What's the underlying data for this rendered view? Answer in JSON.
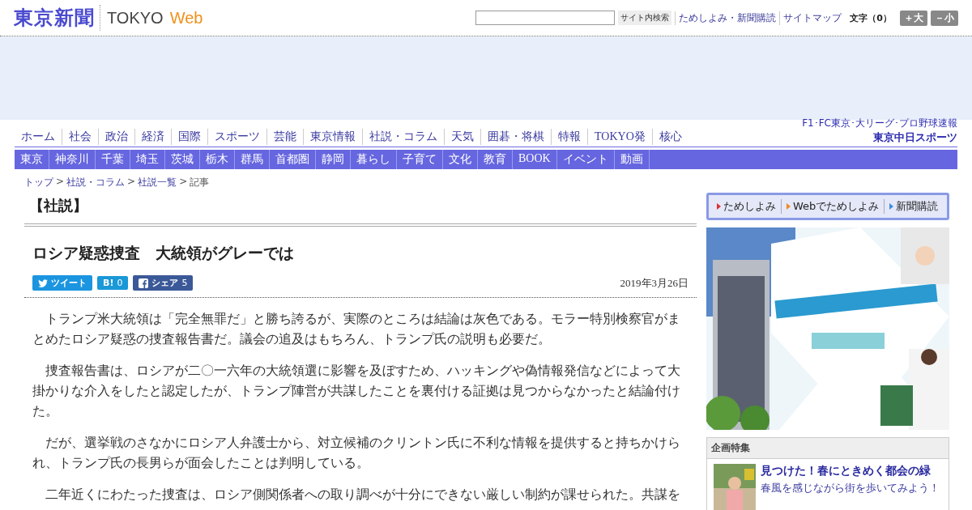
{
  "header": {
    "logo_ja": "東京新聞",
    "logo_en": "TOKYO",
    "logo_web": "Web",
    "search_button": "サイト内検索",
    "links": [
      "ためしよみ・新聞購読",
      "サイトマップ"
    ],
    "font_size_label": "文字（0）",
    "font_buttons": [
      "＋大",
      "－小"
    ]
  },
  "ad_band": {
    "kind": "empty"
  },
  "nav_main": [
    "ホーム",
    "社会",
    "政治",
    "経済",
    "国際",
    "スポーツ",
    "芸能",
    "東京情報",
    "社説・コラム",
    "天気",
    "囲碁・将棋",
    "特報",
    "TOKYO発",
    "核心"
  ],
  "sports_banner": {
    "line1": "F1･FC東京･大リーグ･プロ野球速報",
    "line2": "東京中日スポーツ"
  },
  "nav_regional": [
    "東京",
    "神奈川",
    "千葉",
    "埼玉",
    "茨城",
    "栃木",
    "群馬",
    "首都圏",
    "静岡",
    "暮らし",
    "子育て",
    "文化",
    "教育",
    "BOOK",
    "イベント",
    "動画"
  ],
  "breadcrumb": [
    "トップ",
    "社説・コラム",
    "社説一覧",
    "記事"
  ],
  "breadcrumb_separator": ">",
  "section_title": "【社説】",
  "article": {
    "title": "ロシア疑惑捜査　大統領がグレーでは",
    "share": [
      {
        "kind": "twitter",
        "label": "ツイート"
      },
      {
        "kind": "hatena",
        "label": "B!",
        "count": "0"
      },
      {
        "kind": "facebook",
        "label": "シェア",
        "count": "5"
      }
    ],
    "date": "2019年3月26日",
    "paragraphs": [
      "トランプ米大統領は「完全無罪だ」と勝ち誇るが、実際のところは結論は灰色である。モラー特別検察官がまとめたロシア疑惑の捜査報告書だ。議会の追及はもちろん、トランプ氏の説明も必要だ。",
      "捜査報告書は、ロシアが二〇一六年の大統領選に影響を及ぼすため、ハッキングや偽情報発信などによって大掛かりな介入をしたと認定したが、トランプ陣営が共謀したことを裏付ける証拠は見つからなかったと結論付けた。",
      "だが、選挙戦のさなかにロシア人弁護士から、対立候補のクリントン氏に不利な情報を提供すると持ちかけられ、トランプ氏の長男らが面会したことは判明している。",
      "二年近くにわたった捜査は、ロシア側関係者への取り調べが十分にできない厳しい制約が課せられた。共謀を"
    ]
  },
  "sidebar": {
    "subscribe_links": [
      {
        "label": "ためしよみ",
        "color": "#e03030"
      },
      {
        "label": "Webでためしよみ",
        "color": "#f08a20"
      },
      {
        "label": "新聞購読",
        "color": "#3a8ee0"
      }
    ],
    "feature": {
      "heading": "企画特集",
      "title": "見つけた！春にときめく都会の緑",
      "text": [
        "春風を感じながら街を歩いてみよう！"
      ]
    }
  }
}
